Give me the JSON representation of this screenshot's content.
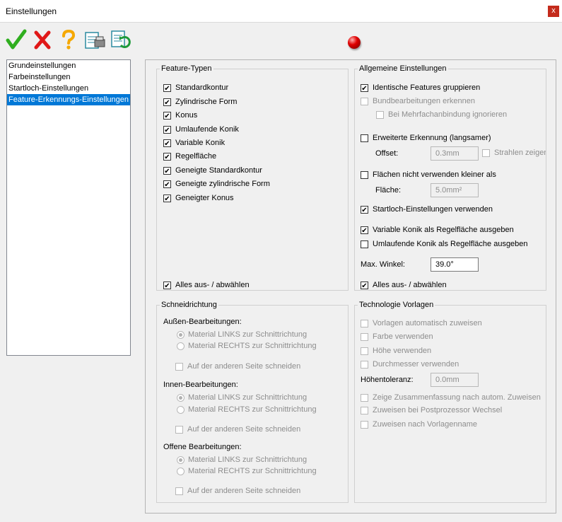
{
  "window": {
    "title": "Einstellungen",
    "close_glyph": "x"
  },
  "toolbar": {
    "icons": [
      "check-icon",
      "cancel-x-icon",
      "help-question-icon",
      "document-print-icon",
      "document-refresh-icon"
    ]
  },
  "status_led_color": "#e00000",
  "nav": {
    "items": [
      "Grundeinstellungen",
      "Farbeinstellungen",
      "Startloch-Einstellungen",
      "Feature-Erkennungs-Einstellungen"
    ],
    "selected_index": 3
  },
  "feature_types": {
    "legend": "Feature-Typen",
    "items": [
      {
        "label": "Standardkontur",
        "checked": true
      },
      {
        "label": "Zylindrische Form",
        "checked": true
      },
      {
        "label": "Konus",
        "checked": true
      },
      {
        "label": "Umlaufende Konik",
        "checked": true
      },
      {
        "label": "Variable Konik",
        "checked": true
      },
      {
        "label": "Regelfläche",
        "checked": true
      },
      {
        "label": "Geneigte Standardkontur",
        "checked": true
      },
      {
        "label": "Geneigte zylindrische Form",
        "checked": true
      },
      {
        "label": "Geneigter Konus",
        "checked": true
      }
    ],
    "select_all": {
      "label": "Alles aus- / abwählen",
      "checked": true
    }
  },
  "general": {
    "legend": "Allgemeine Einstellungen",
    "group_identical": {
      "label": "Identische Features gruppieren",
      "checked": true
    },
    "hole_machining": {
      "label": "Bundbearbeitungen erkennen",
      "checked": false
    },
    "ignore_multi": {
      "label": "Bei Mehrfachanbindung ignorieren",
      "checked": false
    },
    "extended": {
      "label": "Erweiterte Erkennung (langsamer)",
      "checked": false
    },
    "offset_label": "Offset:",
    "offset_value": "0.3mm",
    "rays": {
      "label": "Strahlen zeigen",
      "checked": false
    },
    "min_area": {
      "label": "Flächen nicht verwenden kleiner als",
      "checked": false
    },
    "area_label": "Fläche:",
    "area_value": "5.0mm²",
    "startloch": {
      "label": "Startloch-Einstellungen verwenden",
      "checked": true
    },
    "var_konik": {
      "label": "Variable Konik als Regelfläche ausgeben",
      "checked": true
    },
    "uml_konik": {
      "label": "Umlaufende Konik als Regelfläche ausgeben",
      "checked": false
    },
    "max_angle_label": "Max. Winkel:",
    "max_angle_value": "39.0°",
    "select_all": {
      "label": "Alles aus- / abwählen",
      "checked": true
    }
  },
  "cut_direction": {
    "legend": "Schneidrichtung",
    "groups": [
      {
        "title": "Außen-Bearbeitungen:",
        "left": "Material LINKS zur Schnittrichtung",
        "right": "Material RECHTS zur Schnittrichtung",
        "other_side": "Auf der anderen Seite schneiden"
      },
      {
        "title": "Innen-Bearbeitungen:",
        "left": "Material LINKS zur Schnittrichtung",
        "right": "Material RECHTS zur Schnittrichtung",
        "other_side": "Auf der anderen Seite schneiden"
      },
      {
        "title": "Offene Bearbeitungen:",
        "left": "Material LINKS zur Schnittrichtung",
        "right": "Material RECHTS zur Schnittrichtung",
        "other_side": "Auf der anderen Seite schneiden"
      }
    ]
  },
  "technology": {
    "legend": "Technologie Vorlagen",
    "auto_assign": "Vorlagen automatisch zuweisen",
    "use_color": "Farbe verwenden",
    "use_height": "Höhe verwenden",
    "use_diameter": "Durchmesser verwenden",
    "height_tol_label": "Höhentoleranz:",
    "height_tol_value": "0.0mm",
    "show_summary": "Zeige Zusammenfassung nach autom. Zuweisen",
    "assign_pp": "Zuweisen bei Postprozessor Wechsel",
    "assign_name": "Zuweisen nach Vorlagenname"
  }
}
